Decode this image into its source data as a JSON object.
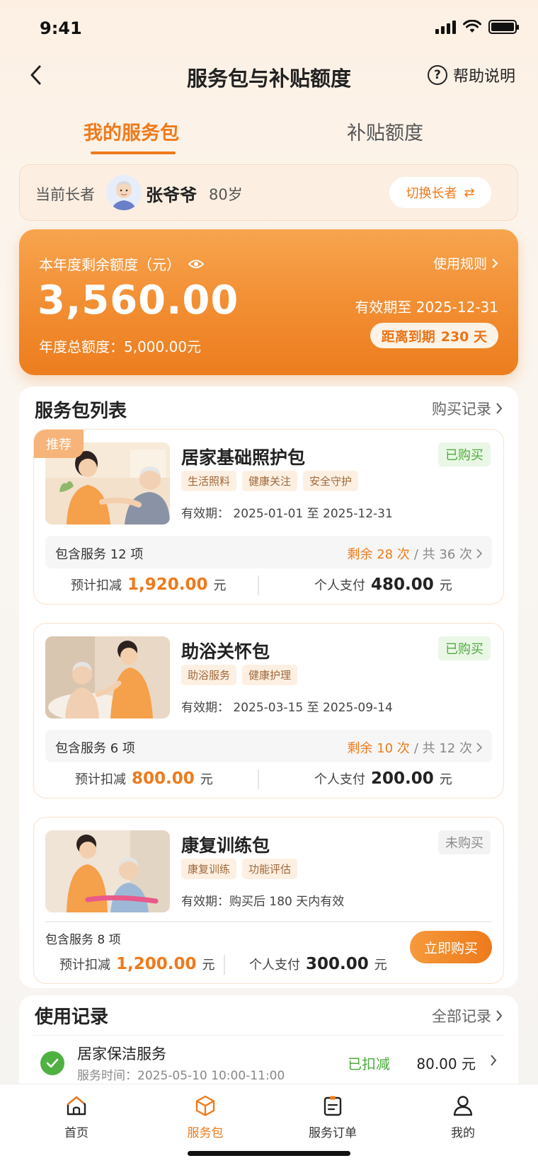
{
  "status_bar": {
    "time": "9:41"
  },
  "nav": {
    "title": "服务包与补贴额度",
    "help": "帮助说明",
    "help_icon_char": "?"
  },
  "tabs": [
    {
      "label": "我的服务包",
      "active": true
    },
    {
      "label": "补贴额度",
      "active": false
    }
  ],
  "elder": {
    "label": "当前长者",
    "name": "张爷爷",
    "age": "80岁",
    "switch_label": "切换长者",
    "switch_icon": "⇄"
  },
  "quota": {
    "label": "本年度剩余额度（元）",
    "amount": "3,560.00",
    "total": "年度总额度：5,000.00元",
    "rules": "使用规则",
    "valid_until": "有效期至  2025-12-31",
    "countdown_label": "距离到期",
    "countdown_value": "230 天"
  },
  "package_list": {
    "title": "服务包列表",
    "link": "购买记录",
    "items": [
      {
        "badge": "推荐",
        "name": "居家基础照护包",
        "status": "已购买",
        "tags": [
          "生活照料",
          "健康关注",
          "安全守护"
        ],
        "validity": "有效期：  2025-01-01  至  2025-12-31",
        "services": "包含服务  12  项",
        "remain": "剩余  28  次",
        "total_count": "/ 共 36 次",
        "deduct_label": "预计扣减",
        "deduct": "1,920.00",
        "pay_label": "个人支付",
        "pay": "480.00",
        "unit": "元"
      },
      {
        "name": "助浴关怀包",
        "status": "已购买",
        "tags": [
          "助浴服务",
          "健康护理"
        ],
        "validity": "有效期：  2025-03-15  至  2025-09-14",
        "services": "包含服务  6  项",
        "remain": "剩余  10  次",
        "total_count": "/ 共 12 次",
        "deduct_label": "预计扣减",
        "deduct": "800.00",
        "pay_label": "个人支付",
        "pay": "200.00",
        "unit": "元"
      },
      {
        "name": "康复训练包",
        "status": "未购买",
        "tags": [
          "康复训练",
          "功能评估"
        ],
        "validity": "有效期：购买后 180 天内有效",
        "services": "包含服务  8  项",
        "deduct_label": "预计扣减",
        "deduct": "1,200.00",
        "pay_label": "个人支付",
        "pay": "300.00",
        "unit": "元",
        "buy_label": "立即购买"
      }
    ]
  },
  "usage": {
    "title": "使用记录",
    "link": "全部记录",
    "records": [
      {
        "name": "居家保洁服务",
        "time": "服务时间：2025-05-10  10:00-11:00",
        "status": "已扣减",
        "amount": "80.00  元"
      }
    ]
  },
  "tabbar": [
    {
      "label": "首页",
      "icon": "home-icon",
      "active": false
    },
    {
      "label": "服务包",
      "icon": "package-icon",
      "active": true
    },
    {
      "label": "服务订单",
      "icon": "order-icon",
      "active": false
    },
    {
      "label": "我的",
      "icon": "user-icon",
      "active": false
    }
  ],
  "colors": {
    "accent": "#ee7a1b",
    "success": "#4dac3c",
    "background": "#fbf5ee"
  }
}
